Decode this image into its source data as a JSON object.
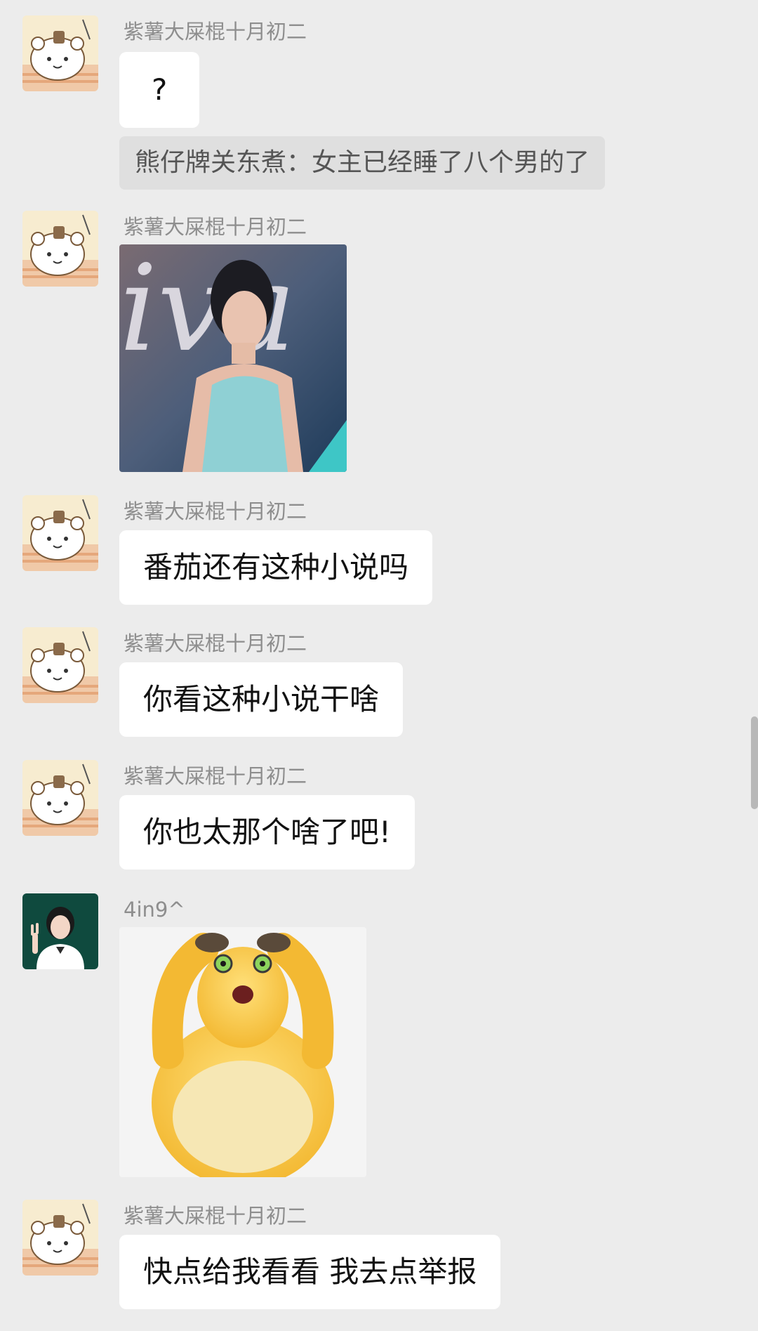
{
  "messages": [
    {
      "sender": "紫薯大屎棍十月初二",
      "text": "?"
    },
    {
      "quote": "熊仔牌关东煮：女主已经睡了八个男的了"
    },
    {
      "sender": "紫薯大屎棍十月初二",
      "image": "photo-of-woman-in-blue-dress"
    },
    {
      "sender": "紫薯大屎棍十月初二",
      "text": "番茄还有这种小说吗"
    },
    {
      "sender": "紫薯大屎棍十月初二",
      "text": "你看这种小说干啥"
    },
    {
      "sender": "紫薯大屎棍十月初二",
      "text": "你也太那个啥了吧!"
    },
    {
      "sender": "4in9^",
      "image": "yellow-shocked-creature-sticker"
    },
    {
      "sender": "紫薯大屎棍十月初二",
      "text": "快点给我看看 我去点举报"
    }
  ],
  "colors": {
    "background": "#ececec",
    "bubble": "#ffffff",
    "quote_bg": "#dfdfdf",
    "sender_text": "#8e8e8e"
  }
}
